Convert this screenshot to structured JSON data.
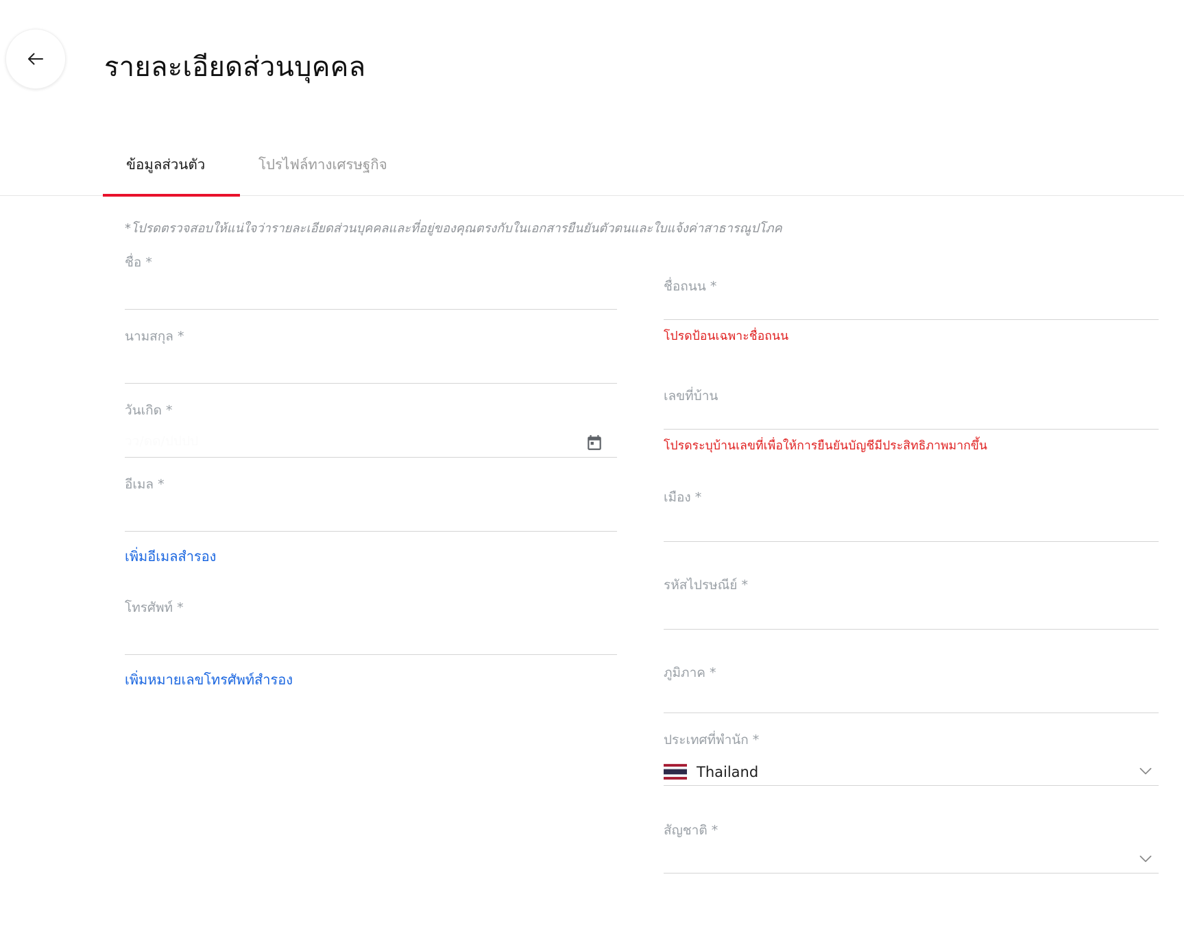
{
  "header": {
    "back_label": "back",
    "title": "รายละเอียดส่วนบุคคล"
  },
  "tabs": [
    {
      "label": "ข้อมูลส่วนตัว",
      "active": true
    },
    {
      "label": "โปรไฟล์ทางเศรษฐกิจ",
      "active": false
    }
  ],
  "disclaimer": "*โปรดตรวจสอบให้แน่ใจว่ารายละเอียดส่วนบุคคลและที่อยู่ของคุณตรงกับในเอกสารยืนยันตัวตนและใบแจ้งค่าสาธารณูปโภค",
  "left_column": {
    "first_name": {
      "label": "ชื่อ *",
      "value": "",
      "placeholder": ""
    },
    "last_name": {
      "label": "นามสกุล *",
      "value": "",
      "placeholder": ""
    },
    "birth_date": {
      "label": "วันเกิด *",
      "value": "",
      "placeholder": "วว/ดด/ปปปป",
      "icon": "calendar-icon"
    },
    "email": {
      "label": "อีเมล *",
      "value": "",
      "placeholder": ""
    },
    "add_email_link": "เพิ่มอีเมลสำรอง",
    "phone": {
      "label": "โทรศัพท์ *",
      "value": "",
      "placeholder": ""
    },
    "add_phone_link": "เพิ่มหมายเลขโทรศัพท์สำรอง"
  },
  "right_column": {
    "street": {
      "label": "ชื่อถนน *",
      "value": "",
      "error": "โปรดป้อนเฉพาะชื่อถนน"
    },
    "house_number": {
      "label": "เลขที่บ้าน",
      "value": "",
      "error": "โปรดระบุบ้านเลขที่เพื่อให้การยืนยันบัญชีมีประสิทธิภาพมากขึ้น"
    },
    "city": {
      "label": "เมือง *",
      "value": ""
    },
    "postcode": {
      "label": "รหัสไปรษณีย์ *",
      "value": ""
    },
    "region": {
      "label": "ภูมิภาค *",
      "value": ""
    },
    "country": {
      "label": "ประเทศที่พำนัก *",
      "value": "Thailand",
      "flag": "thailand-flag",
      "icon": "chevron-down-icon"
    },
    "nationality": {
      "label": "สัญชาติ *",
      "value": "",
      "icon": "chevron-down-icon"
    }
  },
  "colors": {
    "accent": "#e8122b",
    "error": "#e02020",
    "link": "#1a66e0",
    "label": "#9aa0a6"
  }
}
